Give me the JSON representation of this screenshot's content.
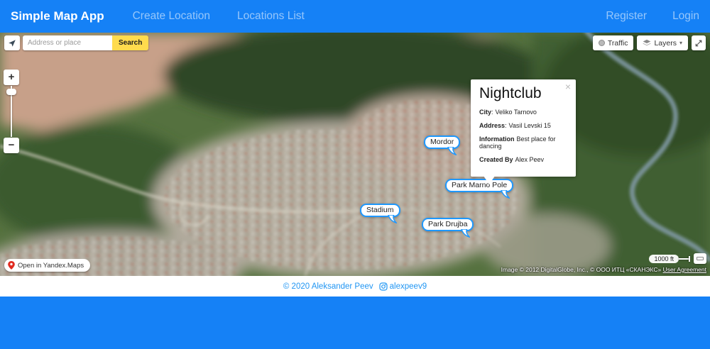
{
  "colors": {
    "primary_blue": "#1581f6",
    "search_yellow": "#ffdb4d",
    "balloon_blue": "#1e98ff",
    "footer_link_blue": "#2196f3"
  },
  "navbar": {
    "brand": "Simple Map App",
    "links": [
      {
        "label": "Create Location"
      },
      {
        "label": "Locations List"
      }
    ],
    "auth_links": [
      {
        "label": "Register"
      },
      {
        "label": "Login"
      }
    ]
  },
  "map": {
    "search": {
      "placeholder": "Address or place",
      "button_label": "Search"
    },
    "top_controls": {
      "traffic_label": "Traffic",
      "layers_label": "Layers",
      "chevron": "▾"
    },
    "zoom": {
      "in": "+",
      "out": "−"
    },
    "markers": [
      {
        "label": "Mordor"
      },
      {
        "label": "Park Marno Pole"
      },
      {
        "label": "Stadium"
      },
      {
        "label": "Park Drujba"
      }
    ],
    "popup": {
      "title": "Nightclub",
      "close": "×",
      "fields": [
        {
          "label": "City",
          "sep": ":",
          "value": "Veliko Tarnovo"
        },
        {
          "label": "Address",
          "sep": ":",
          "value": "Vasil Levski 15"
        },
        {
          "label": "Information",
          "sep": "",
          "value": "Best place for dancing"
        },
        {
          "label": "Created By",
          "sep": "",
          "value": "Alex Peev"
        }
      ]
    },
    "badge_label": "Open in Yandex.Maps",
    "scale_label": "1000 ft",
    "attribution": "Image © 2012 DigitalGlobe, Inc., © ООО ИТЦ «СКАНЭКС»",
    "user_agreement": "User Agreement"
  },
  "footer": {
    "copyright": "© 2020 Aleksander Peev",
    "handle": "alexpeev9"
  }
}
